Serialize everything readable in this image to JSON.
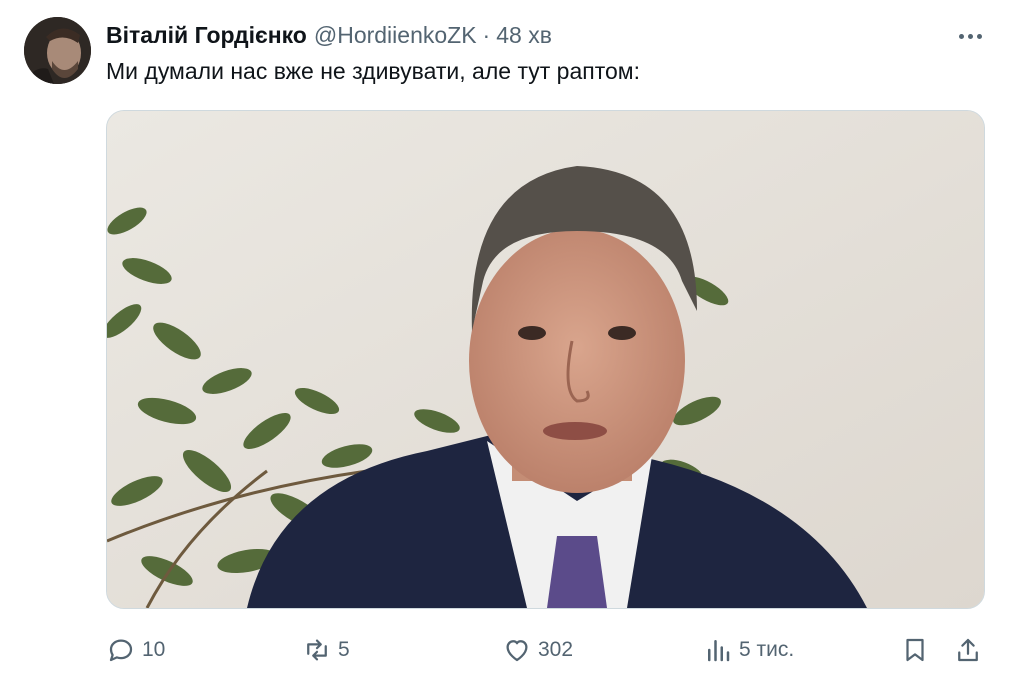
{
  "author": {
    "name": "Віталій Гордієнко",
    "handle": "@HordiienkoZK",
    "separator": "·",
    "time": "48 хв"
  },
  "tweet": {
    "text": "Ми думали нас вже не здивувати, але тут раптом:"
  },
  "icons": {
    "more": "more-horizontal-icon",
    "reply": "reply-icon",
    "retweet": "retweet-icon",
    "like": "heart-icon",
    "views": "views-icon",
    "bookmark": "bookmark-icon",
    "share": "share-icon"
  },
  "actions": {
    "replies": "10",
    "retweets": "5",
    "likes": "302",
    "views": "5 тис."
  },
  "colors": {
    "text_primary": "#0f1419",
    "text_secondary": "#536471",
    "media_border": "#cfd9de"
  }
}
